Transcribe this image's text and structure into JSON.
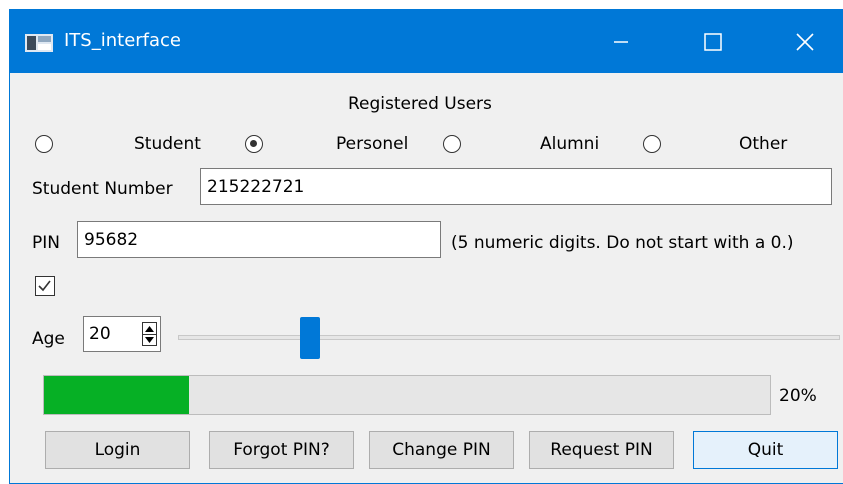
{
  "window": {
    "title": "ITS_interface"
  },
  "group_title": "Registered Users",
  "radios": [
    {
      "label": "Student",
      "selected": false
    },
    {
      "label": "Personel",
      "selected": true
    },
    {
      "label": "Alumni",
      "selected": false
    },
    {
      "label": "Other",
      "selected": false
    }
  ],
  "student_number": {
    "label": "Student Number",
    "value": "215222721"
  },
  "pin": {
    "label": "PIN",
    "value": "95682",
    "hint": "(5 numeric digits. Do not start with a 0.)"
  },
  "checkbox": {
    "checked": true
  },
  "age": {
    "label": "Age",
    "value": "20"
  },
  "slider": {
    "fraction": 0.2
  },
  "progress": {
    "percent": 20,
    "text": "20%"
  },
  "buttons": {
    "login": "Login",
    "forgot": "Forgot PIN?",
    "change": "Change PIN",
    "request": "Request PIN",
    "quit": "Quit"
  },
  "colors": {
    "accent": "#0078d7",
    "progress": "#06b025",
    "window_bg": "#f0f0f0"
  }
}
